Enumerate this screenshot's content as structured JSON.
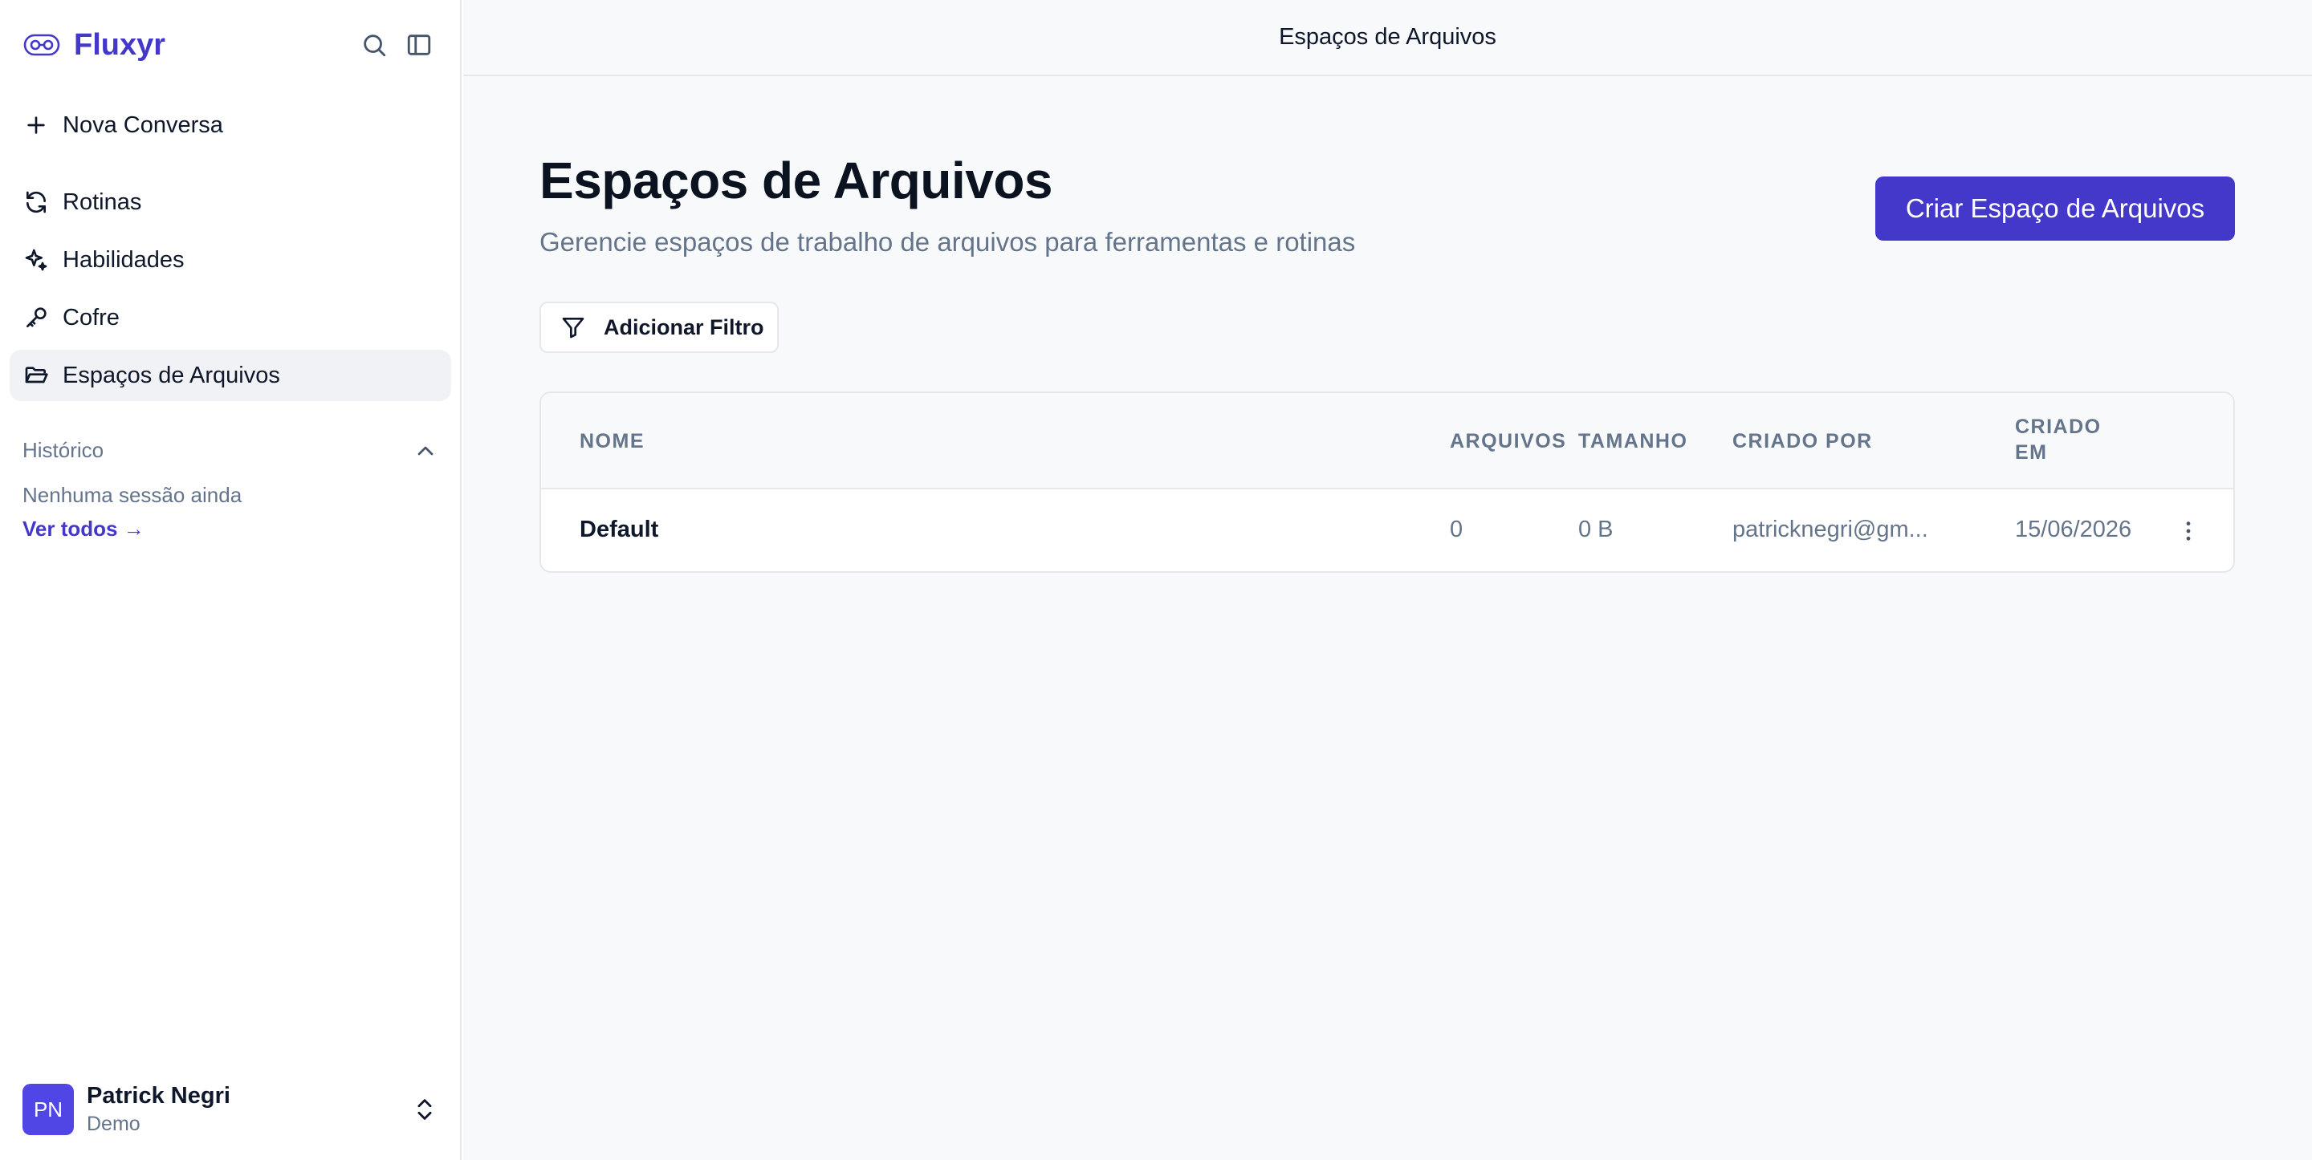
{
  "brand": {
    "name": "Fluxyr"
  },
  "sidebar": {
    "new_chat": "Nova Conversa",
    "items": [
      {
        "label": "Rotinas",
        "icon": "refresh-icon"
      },
      {
        "label": "Habilidades",
        "icon": "sparkles-icon"
      },
      {
        "label": "Cofre",
        "icon": "key-icon"
      },
      {
        "label": "Espaços de Arquivos",
        "icon": "folder-open-icon",
        "active": true
      }
    ],
    "history": {
      "title": "Histórico",
      "empty": "Nenhuma sessão ainda",
      "see_all": "Ver todos →"
    },
    "user": {
      "initials": "PN",
      "name": "Patrick Negri",
      "org": "Demo"
    }
  },
  "topbar": {
    "title": "Espaços de Arquivos"
  },
  "page": {
    "title": "Espaços de Arquivos",
    "subtitle": "Gerencie espaços de trabalho de arquivos para ferramentas e rotinas",
    "create_button": "Criar Espaço de Arquivos",
    "filter_button": "Adicionar Filtro"
  },
  "table": {
    "headers": {
      "name": "NOME",
      "files": "ARQUIVOS",
      "size": "TAMANHO",
      "created_by": "CRIADO POR",
      "created_at_1": "CRIADO",
      "created_at_2": "EM"
    },
    "rows": [
      {
        "name": "Default",
        "files": "0",
        "size": "0 B",
        "created_by": "patricknegri@gm...",
        "created_at": "15/06/2026"
      }
    ]
  },
  "colors": {
    "accent": "#4338ca",
    "muted": "#64748b",
    "border": "#e5e7eb",
    "main_bg": "#f8f9fb"
  }
}
